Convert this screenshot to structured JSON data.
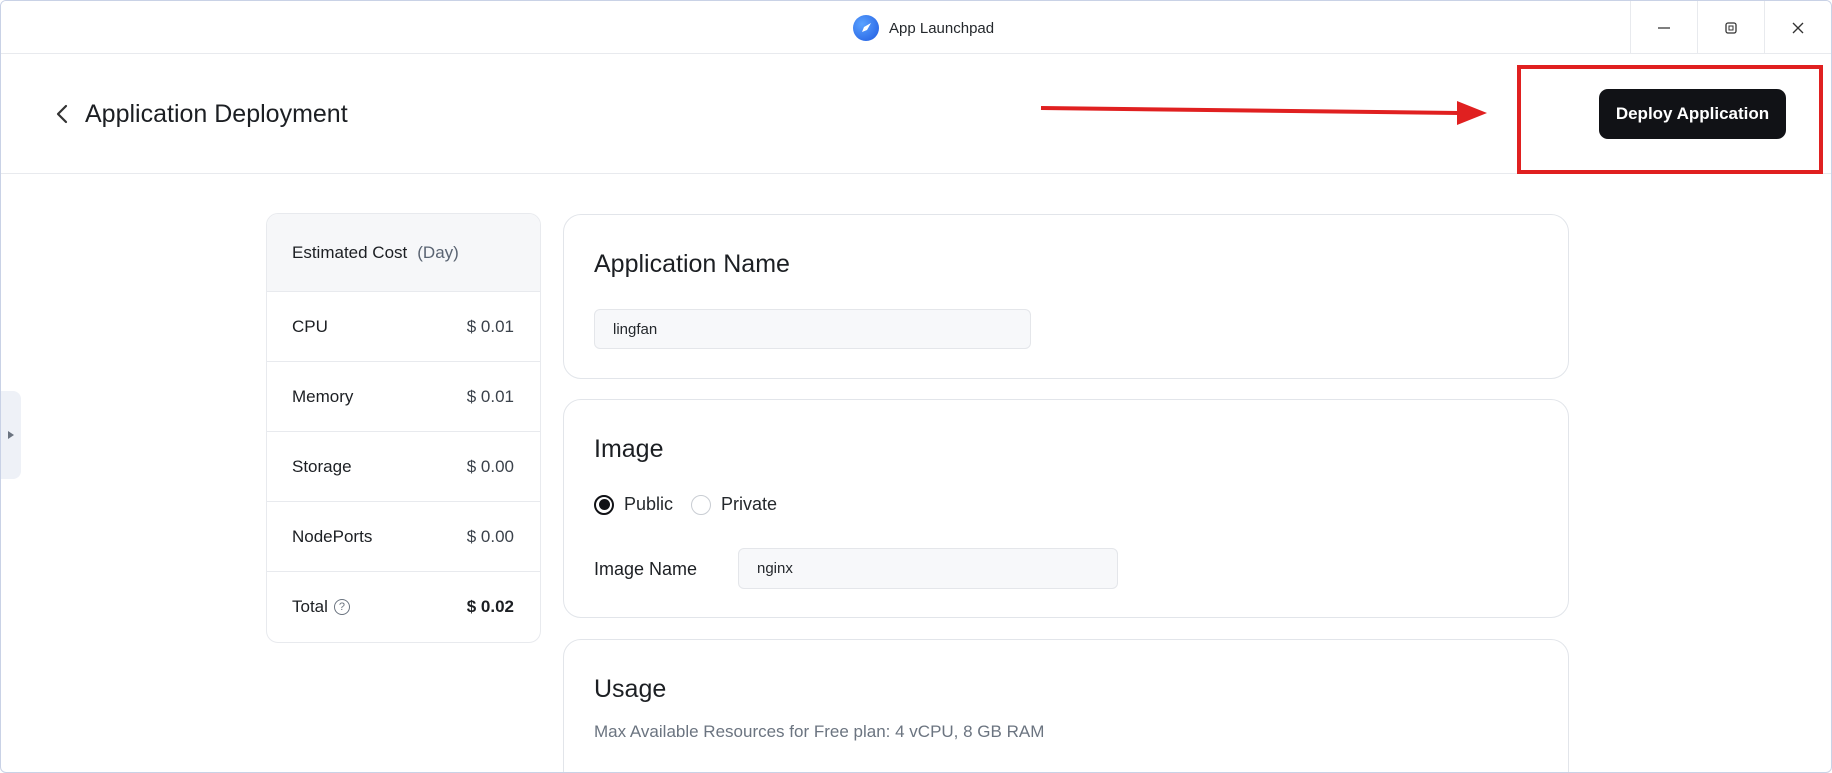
{
  "titlebar": {
    "app_name": "App Launchpad"
  },
  "header": {
    "title": "Application Deployment",
    "deploy_label": "Deploy Application"
  },
  "cost": {
    "title": "Estimated Cost",
    "unit": "(Day)",
    "rows": [
      {
        "name": "CPU",
        "value": "$ 0.01"
      },
      {
        "name": "Memory",
        "value": "$ 0.01"
      },
      {
        "name": "Storage",
        "value": "$ 0.00"
      },
      {
        "name": "NodePorts",
        "value": "$ 0.00"
      },
      {
        "name": "Total",
        "value": "$ 0.02"
      }
    ]
  },
  "app_name_card": {
    "title": "Application Name",
    "value": "lingfan"
  },
  "image_card": {
    "title": "Image",
    "options": [
      "Public",
      "Private"
    ],
    "selected": "Public",
    "image_name_label": "Image Name",
    "image_name_value": "nginx"
  },
  "usage_card": {
    "title": "Usage",
    "description": "Max Available Resources for Free plan: 4 vCPU, 8 GB RAM"
  },
  "colors": {
    "primary": "#111216",
    "annotation": "#e02020",
    "border": "#e2e5ea"
  }
}
